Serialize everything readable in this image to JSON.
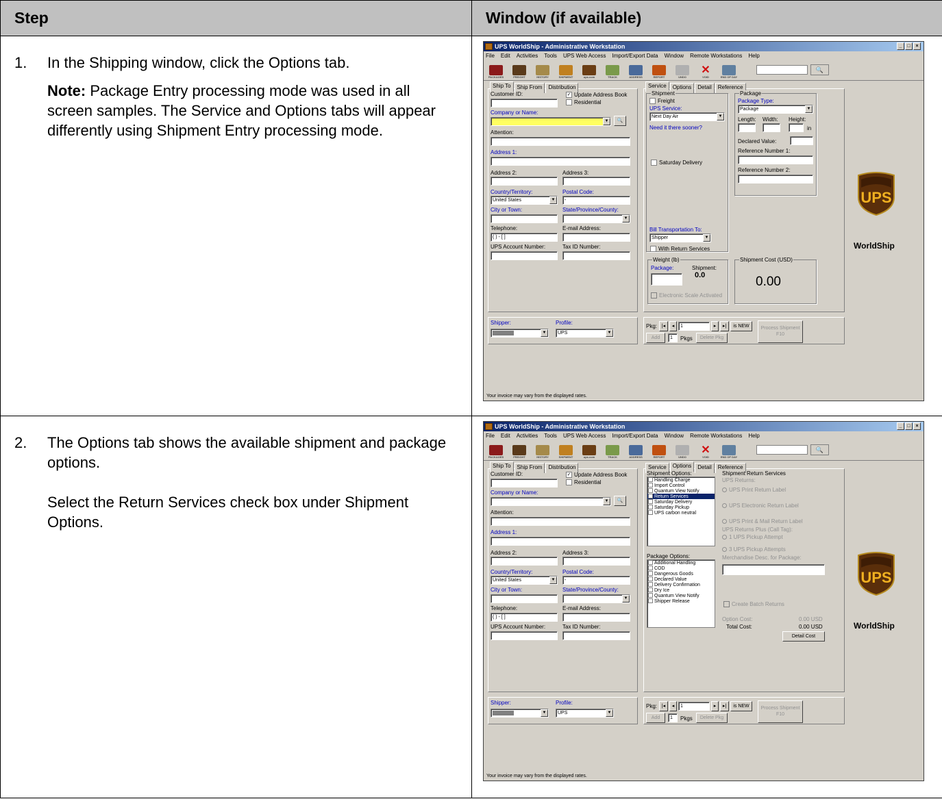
{
  "table": {
    "header_step": "Step",
    "header_window": "Window (if available)"
  },
  "rows": [
    {
      "num": "1.",
      "text": "In the Shipping window, click the Options tab.",
      "note_label": "Note:",
      "note_text": " Package Entry processing mode was used in all screen samples. The Service and Options tabs will appear differently using Shipment Entry processing mode."
    },
    {
      "num": "2.",
      "text": "The Options tab shows the available shipment and package options.",
      "text2": "Select the Return Services check box under Shipment Options."
    }
  ],
  "window": {
    "title": "UPS WorldShip - Administrative Workstation",
    "menu": [
      "File",
      "Edit",
      "Activities",
      "Tools",
      "UPS Web Access",
      "Import/Export Data",
      "Window",
      "Remote Workstations",
      "Help"
    ],
    "toolbar": [
      "PACKAGES",
      "FREIGHT",
      "HISTORY",
      "SHIPMENT",
      "ups.com",
      "TRACK",
      "ADDRESS",
      "REPORT",
      "UNDO",
      "VOID",
      "END OF DAY"
    ],
    "left_tabs": [
      "Ship To",
      "Ship From",
      "Distribution"
    ],
    "fields": {
      "customer_id": "Customer ID:",
      "update_book": "Update Address Book",
      "residential": "Residential",
      "company": "Company or Name:",
      "attention": "Attention:",
      "address1": "Address 1:",
      "address2": "Address 2:",
      "address3": "Address 3:",
      "country": "Country/Territory:",
      "postal": "Postal Code:",
      "country_val": "United States",
      "postal_val": "-",
      "city": "City or Town:",
      "state": "State/Province/County:",
      "telephone": "Telephone:",
      "email": "E-mail Address:",
      "phone_val": "( )  -  [ ]",
      "acct": "UPS Account Number:",
      "taxid": "Tax ID Number:"
    },
    "right_tabs": [
      "Service",
      "Options",
      "Detail",
      "Reference"
    ],
    "service": {
      "shipment": "Shipment",
      "freight": "Freight",
      "ups_service": "UPS Service:",
      "service_val": "Next Day Air",
      "sooner": "Need it there sooner?",
      "saturday": "Saturday Delivery",
      "package": "Package",
      "package_type": "Package Type:",
      "package_val": "Package",
      "length": "Length:",
      "width": "Width:",
      "height": "Height:",
      "in": "in",
      "declared": "Declared Value:",
      "ref1": "Reference Number 1:",
      "ref2": "Reference Number 2:",
      "bill": "Bill Transportation To:",
      "bill_val": "Shipper",
      "return": "With Return Services",
      "weight": "Weight (lb)",
      "pkg": "Package:",
      "shipment_w": "Shipment:",
      "weight_val": "0.0",
      "scale": "Electronic Scale Activated",
      "cost": "Shipment Cost (USD)",
      "cost_val": "0.00"
    },
    "options": {
      "shipment_options": "Shipment Options:",
      "ship_list": [
        "Handling Charge",
        "Import Control",
        "Quantum View Notify",
        "Return Services",
        "Saturday Delivery",
        "Saturday Pickup",
        "UPS carbon neutral"
      ],
      "package_options": "Package Options:",
      "pkg_list": [
        "Additional Handling",
        "COD",
        "Dangerous Goods",
        "Declared Value",
        "Delivery Confirmation",
        "Dry Ice",
        "Quantum View Notify",
        "Shipper Release"
      ],
      "srs": "Shipment Return Services",
      "ups_returns": "UPS Returns:",
      "r1": "UPS Print Return Label",
      "r2": "UPS Electronic Return Label",
      "r3": "UPS Print & Mail Return Label",
      "plus": "UPS Returns Plus (Call Tag):",
      "r4": "1 UPS Pickup Attempt",
      "r5": "3 UPS Pickup Attempts",
      "merch": "Merchandise Desc. for Package:",
      "batch": "Create Batch Returns",
      "option_cost": "Option Cost:",
      "option_cost_val": "0.00 USD",
      "total": "Total Cost:",
      "total_val": "0.00 USD",
      "detail_btn": "Detail Cost"
    },
    "bottom": {
      "shipper": "Shipper:",
      "profile": "Profile:",
      "shipper_val": "00000000",
      "profile_val": "UPS",
      "pkg": "Pkg:",
      "pkg_num": "1",
      "isnew": "is NEW",
      "add": "Add",
      "pkgs_num": "1",
      "pkgs": "Pkgs",
      "delete": "Delete Pkg",
      "process": "Process Shipment",
      "f10": "F10"
    },
    "brand": "WorldShip",
    "logo": "UPS",
    "status": "Your invoice may vary from the displayed rates."
  }
}
